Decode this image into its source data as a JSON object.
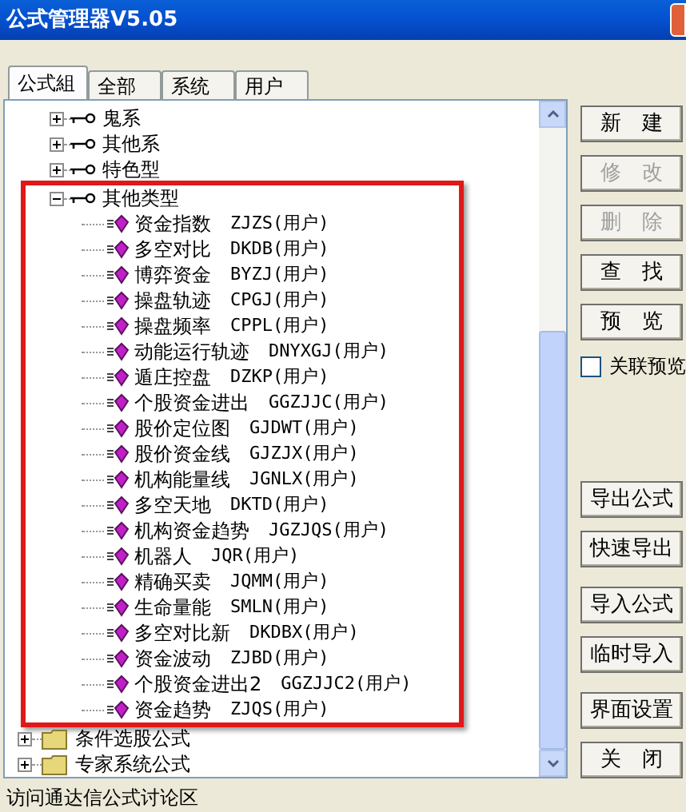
{
  "window": {
    "title": "公式管理器V5.05"
  },
  "tabs": [
    {
      "label": "公式組",
      "selected": true
    },
    {
      "label": "全部",
      "selected": false
    },
    {
      "label": "系统",
      "selected": false
    },
    {
      "label": "用户",
      "selected": false
    }
  ],
  "tree": [
    {
      "kind": "group",
      "label": "鬼系",
      "expanded": false
    },
    {
      "kind": "group",
      "label": "其他系",
      "expanded": false
    },
    {
      "kind": "group",
      "label": "特色型",
      "expanded": false
    },
    {
      "kind": "group",
      "label": "其他类型",
      "expanded": true,
      "highlighted": true,
      "children": [
        {
          "kind": "formula",
          "label": "资金指数",
          "code": "ZJZS(用户)"
        },
        {
          "kind": "formula",
          "label": "多空对比",
          "code": "DKDB(用户)"
        },
        {
          "kind": "formula",
          "label": "博弈资金",
          "code": "BYZJ(用户)"
        },
        {
          "kind": "formula",
          "label": "操盘轨迹",
          "code": "CPGJ(用户)"
        },
        {
          "kind": "formula",
          "label": "操盘频率",
          "code": "CPPL(用户)"
        },
        {
          "kind": "formula",
          "label": "动能运行轨迹",
          "code": "DNYXGJ(用户)"
        },
        {
          "kind": "formula",
          "label": "遁庄控盘",
          "code": "DZKP(用户)"
        },
        {
          "kind": "formula",
          "label": "个股资金进出",
          "code": "GGZJJC(用户)"
        },
        {
          "kind": "formula",
          "label": "股价定位图",
          "code": "GJDWT(用户)"
        },
        {
          "kind": "formula",
          "label": "股价资金线",
          "code": "GJZJX(用户)"
        },
        {
          "kind": "formula",
          "label": "机构能量线",
          "code": "JGNLX(用户)"
        },
        {
          "kind": "formula",
          "label": "多空天地",
          "code": "DKTD(用户)"
        },
        {
          "kind": "formula",
          "label": "机构资金趋势",
          "code": "JGZJQS(用户)"
        },
        {
          "kind": "formula",
          "label": "机器人",
          "code": "JQR(用户)"
        },
        {
          "kind": "formula",
          "label": "精确买卖",
          "code": "JQMM(用户)"
        },
        {
          "kind": "formula",
          "label": "生命量能",
          "code": "SMLN(用户)"
        },
        {
          "kind": "formula",
          "label": "多空对比新",
          "code": "DKDBX(用户)"
        },
        {
          "kind": "formula",
          "label": "资金波动",
          "code": "ZJBD(用户)"
        },
        {
          "kind": "formula",
          "label": "个股资金进出2",
          "code": "GGZJJC2(用户)"
        },
        {
          "kind": "formula",
          "label": "资金趋势",
          "code": "ZJQS(用户)"
        }
      ]
    },
    {
      "kind": "folder",
      "label": "条件选股公式",
      "expanded": false
    },
    {
      "kind": "folder",
      "label": "专家系统公式",
      "expanded": false
    }
  ],
  "buttons_top": [
    {
      "label": "新　建",
      "disabled": false
    },
    {
      "label": "修　改",
      "disabled": true
    },
    {
      "label": "删　除",
      "disabled": true
    },
    {
      "label": "查　找",
      "disabled": false
    },
    {
      "label": "预　览",
      "disabled": false
    }
  ],
  "checkbox": {
    "label": "关联预览",
    "checked": false
  },
  "button_groups": [
    {
      "buttons": [
        {
          "label": "导出公式",
          "disabled": false
        },
        {
          "label": "快速导出",
          "disabled": false
        }
      ]
    },
    {
      "buttons": [
        {
          "label": "导入公式",
          "disabled": false
        },
        {
          "label": "临时导入",
          "disabled": false
        }
      ]
    },
    {
      "buttons": [
        {
          "label": "界面设置",
          "disabled": false
        },
        {
          "label": "关　闭",
          "disabled": false
        }
      ]
    }
  ],
  "status_bar": {
    "text": "访问通达信公式讨论区"
  }
}
